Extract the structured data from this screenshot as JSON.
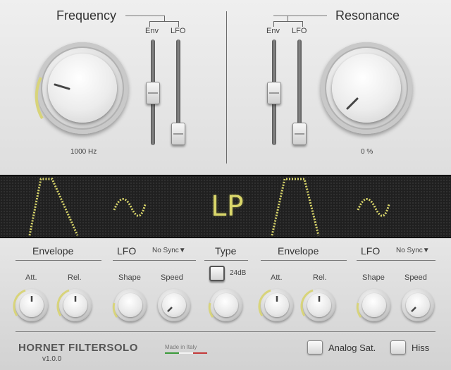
{
  "frequency": {
    "title": "Frequency",
    "env_label": "Env",
    "lfo_label": "LFO",
    "value": "1000 Hz"
  },
  "resonance": {
    "title": "Resonance",
    "env_label": "Env",
    "lfo_label": "LFO",
    "value": "0 %"
  },
  "display": {
    "mode_text": "LP",
    "color": "#d9d66a"
  },
  "bottom": {
    "left_envelope": {
      "title": "Envelope",
      "att": "Att.",
      "rel": "Rel."
    },
    "left_lfo": {
      "title": "LFO",
      "sync": "No Sync▼",
      "shape": "Shape",
      "speed": "Speed"
    },
    "type": {
      "title": "Type",
      "button_label": "24dB"
    },
    "right_envelope": {
      "title": "Envelope",
      "att": "Att.",
      "rel": "Rel."
    },
    "right_lfo": {
      "title": "LFO",
      "sync": "No Sync▼",
      "shape": "Shape",
      "speed": "Speed"
    }
  },
  "footer": {
    "brand": "HORNET FILTERSOLO",
    "version": "v1.0.0",
    "made_in": "Made in Italy",
    "analog_sat": "Analog Sat.",
    "hiss": "Hiss"
  },
  "accent_color": "#d8d47a"
}
